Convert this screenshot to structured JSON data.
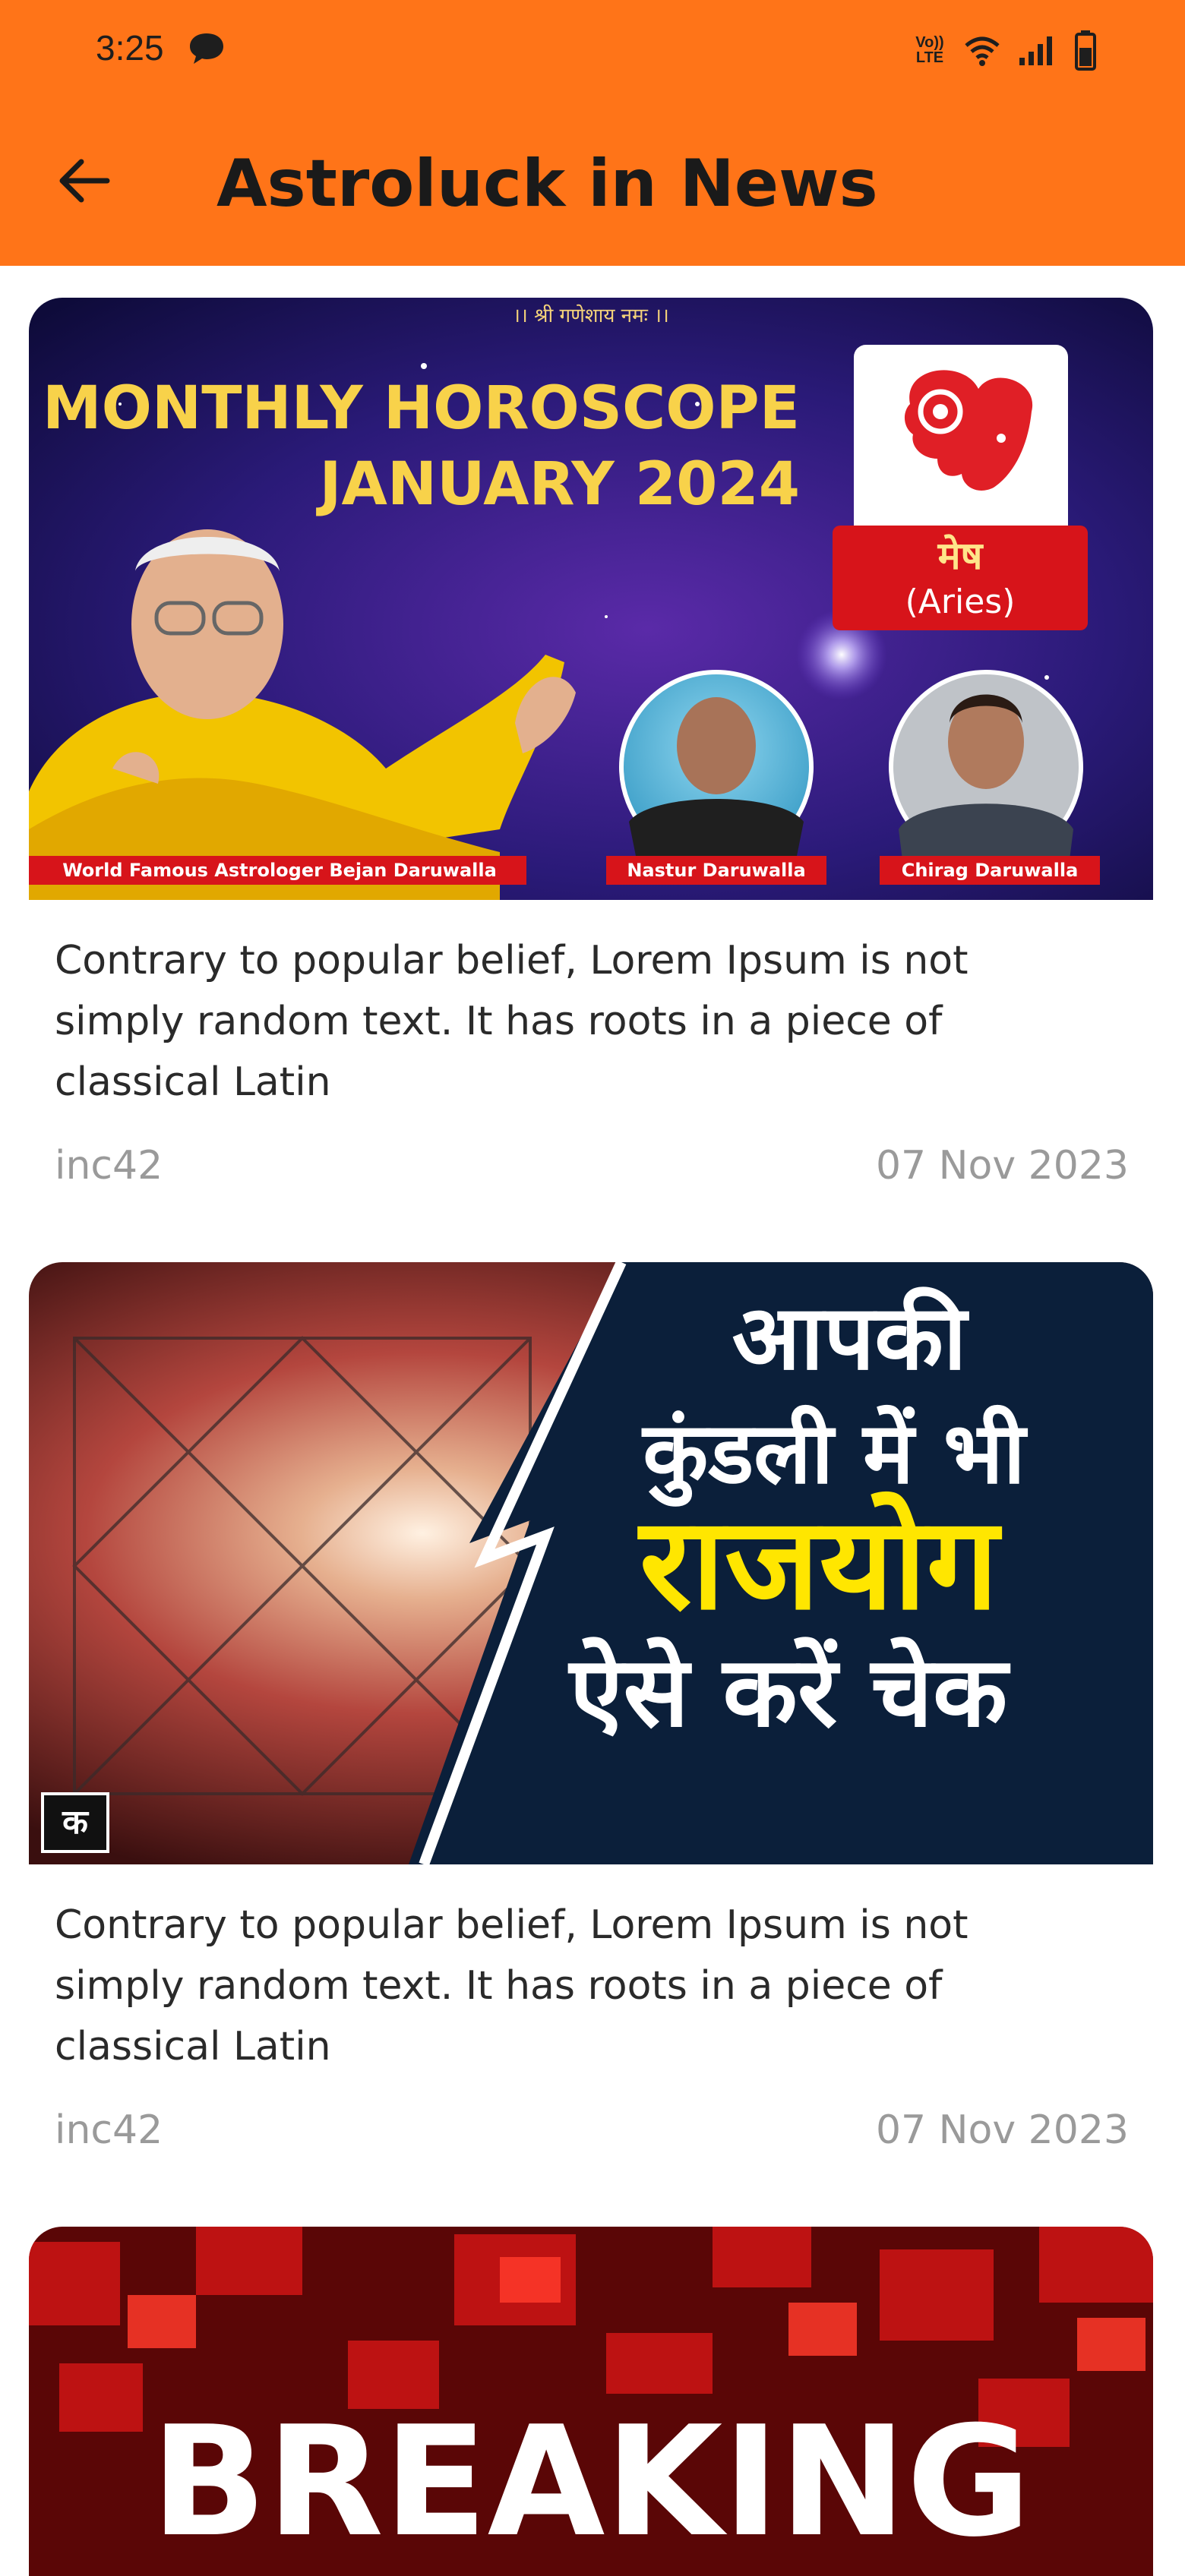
{
  "status_bar": {
    "time": "3:25",
    "network_label": "Vo)) LTE"
  },
  "app_bar": {
    "title": "Astroluck in News",
    "back_icon": "arrow-left-icon"
  },
  "colors": {
    "app_bar": "#FF7418",
    "meta_text": "#9a9a9a"
  },
  "news": [
    {
      "image": {
        "top_text": "।। श्री गणेशाय नमः ।।",
        "heading_line1": "MONTHLY HOROSCOPE",
        "heading_line2": "JANUARY 2024",
        "sign_hindi": "मेष",
        "sign_english": "(Aries)",
        "caption_1": "World Famous Astrologer Bejan Daruwalla",
        "caption_2": "Nastur Daruwalla",
        "caption_3": "Chirag Daruwalla"
      },
      "description": "Contrary to popular belief, Lorem Ipsum is not simply random text. It has roots in a piece of classical Latin",
      "source": "inc42",
      "date": "07 Nov 2023"
    },
    {
      "image": {
        "line1": "आपकी",
        "line2": "कुंडली में भी",
        "line3": "राजयोग",
        "line4": "ऐसे करें चेक",
        "logo_letter": "क"
      },
      "description": "Contrary to popular belief, Lorem Ipsum is not simply random text. It has roots in a piece of classical Latin",
      "source": "inc42",
      "date": "07 Nov 2023"
    },
    {
      "image": {
        "headline": "BREAKING"
      }
    }
  ]
}
